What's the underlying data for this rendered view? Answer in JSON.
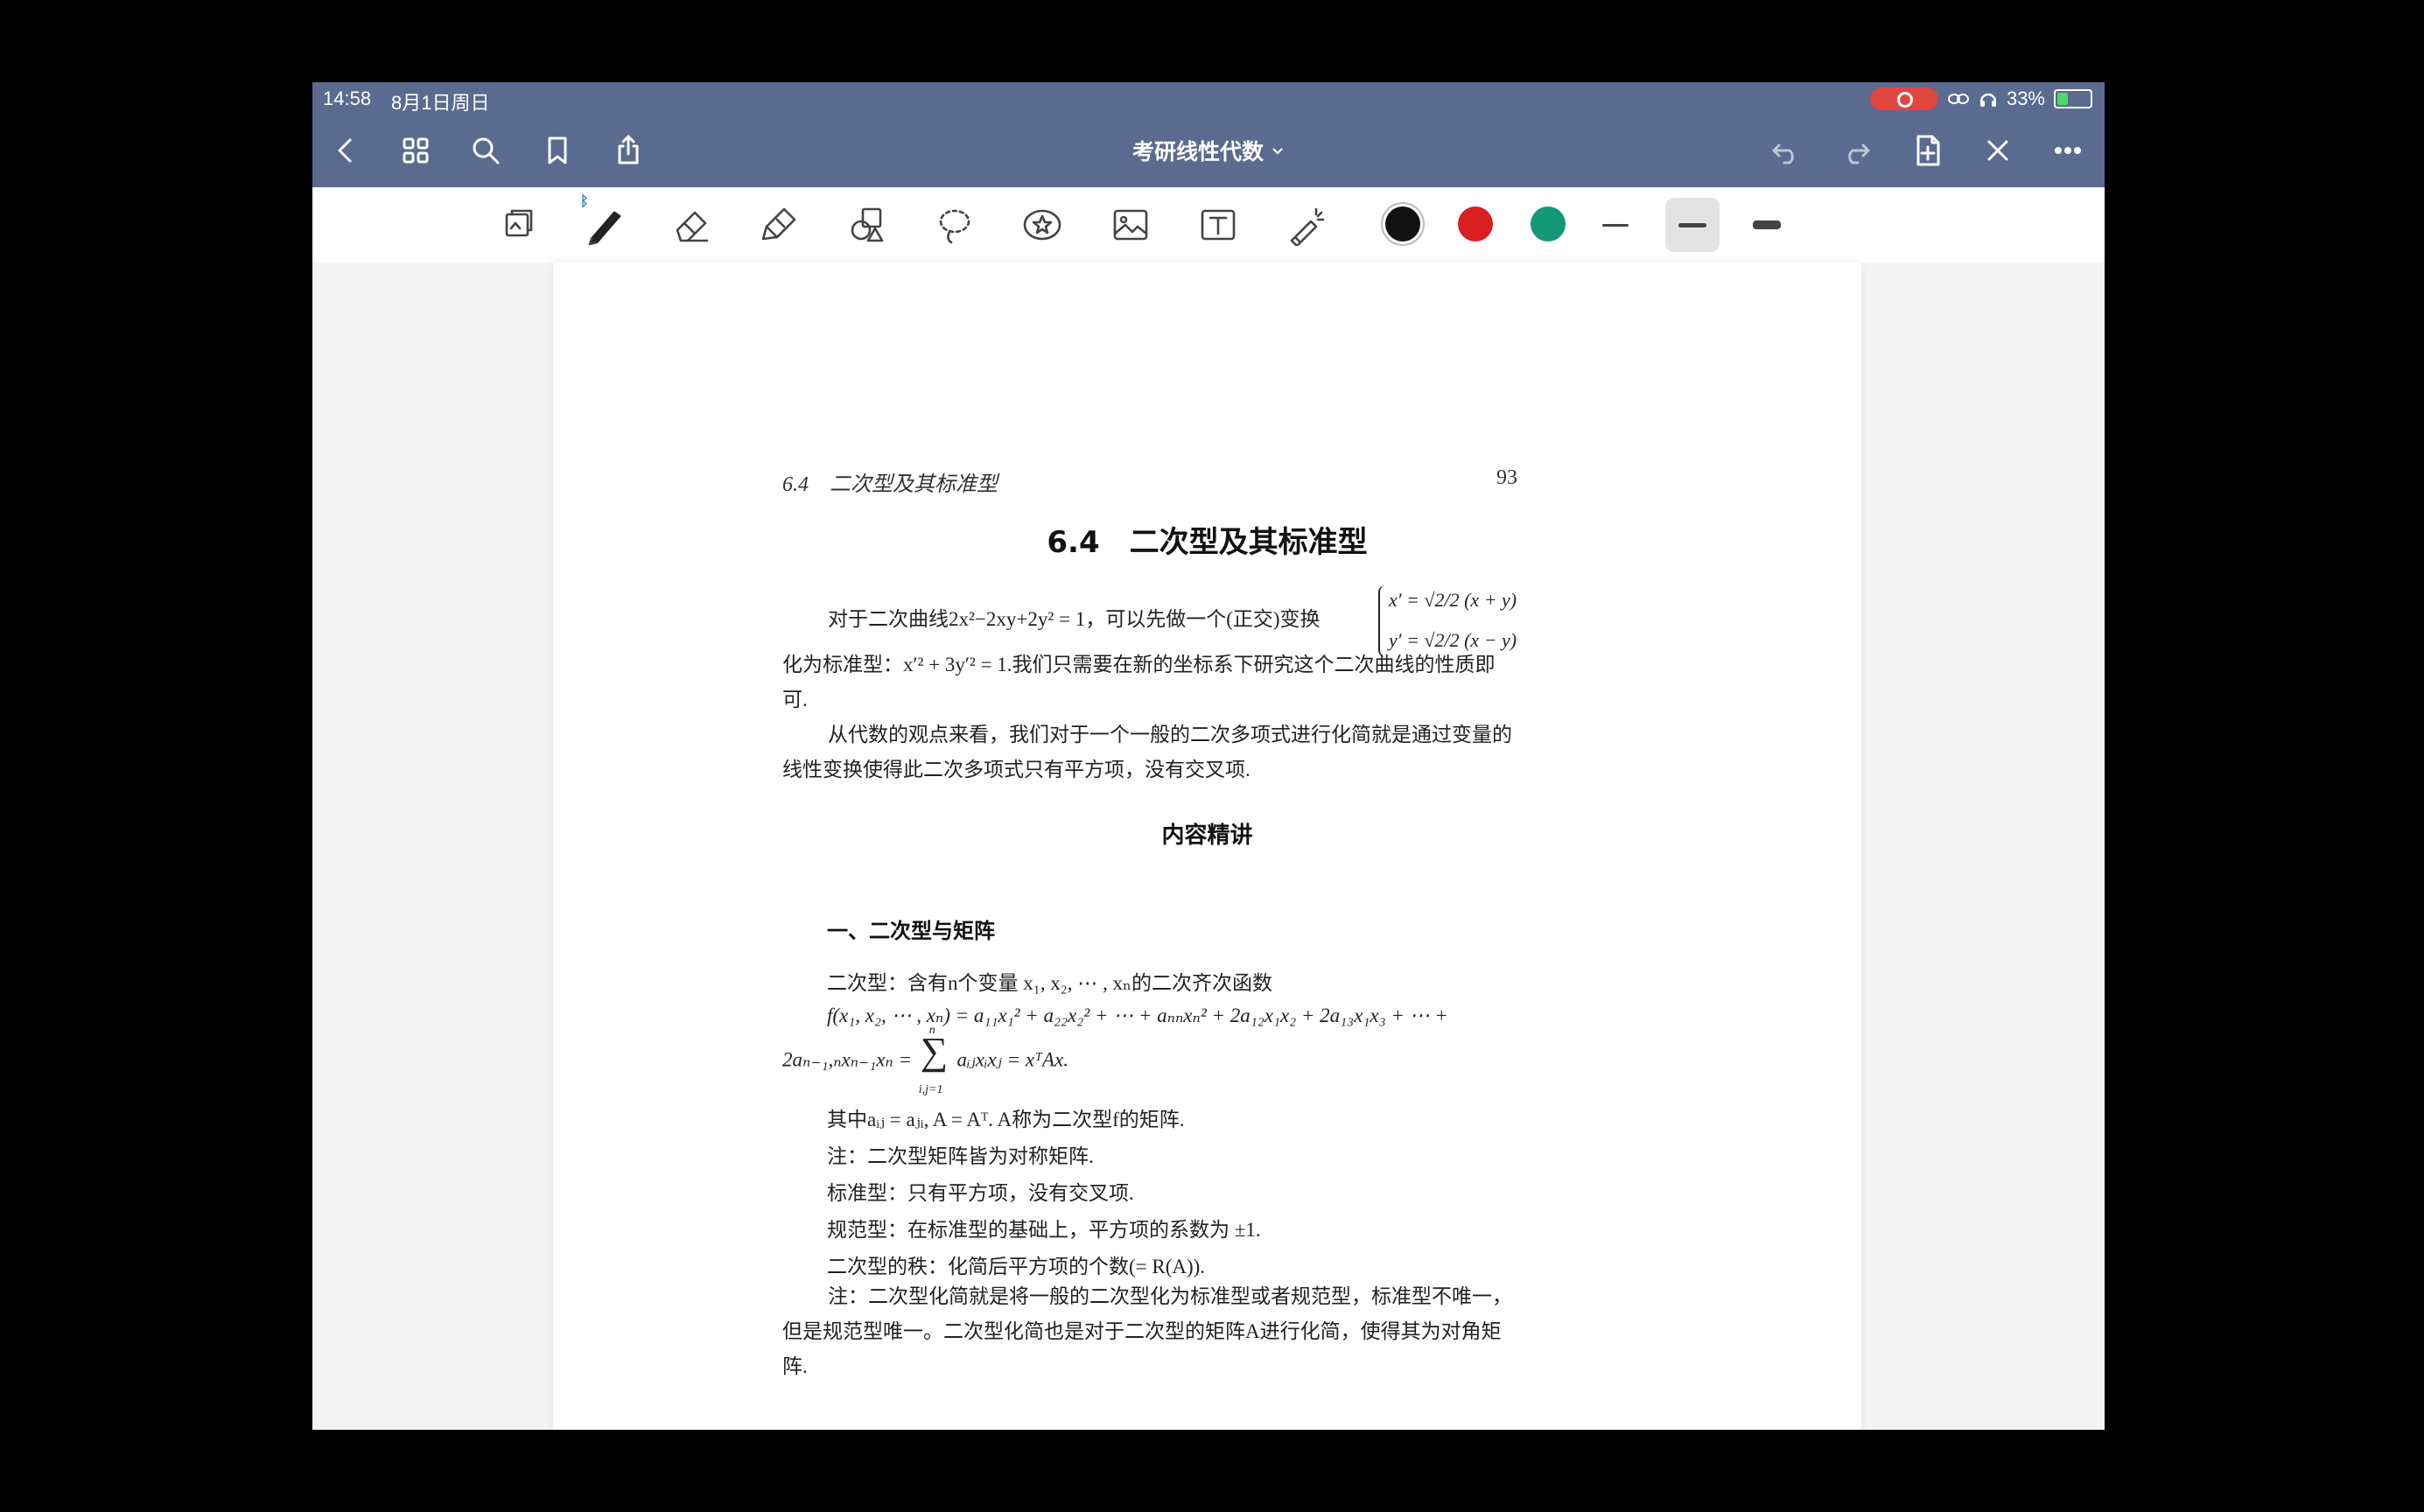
{
  "status": {
    "time": "14:58",
    "date": "8月1日周日",
    "battery": "33%",
    "battery_level": 0.33
  },
  "nav": {
    "title": "考研线性代数",
    "icons": [
      "back-icon",
      "grid-icon",
      "search-icon",
      "bookmark-icon",
      "share-icon",
      "undo-icon",
      "redo-icon",
      "add-page-icon",
      "close-icon",
      "more-icon"
    ]
  },
  "toolbar": {
    "tools": [
      "page-view-icon",
      "pen-icon",
      "eraser-icon",
      "highlighter-icon",
      "shapes-icon",
      "lasso-icon",
      "sticker-icon",
      "image-icon",
      "text-icon",
      "laser-pointer-icon"
    ],
    "colors": [
      "#111111",
      "#d91f1f",
      "#139978"
    ],
    "selected_color": "#111111",
    "thickness_options": [
      "thin",
      "medium",
      "thick"
    ],
    "selected_thickness": "medium"
  },
  "page": {
    "running_header_left": "6.4　二次型及其标准型",
    "page_number": "93",
    "section_title": "6.4　二次型及其标准型",
    "intro_1": "对于二次曲线2x²−2xy+2y² = 1，可以先做一个(正交)变换",
    "transform_x": "x′ = √2/2 (x + y)",
    "transform_y": "y′ = √2/2 (x − y)",
    "intro_2": "化为标准型：x′² + 3y′² = 1.我们只需要在新的坐标系下研究这个二次曲线的性质即可.",
    "intro_3": "从代数的观点来看，我们对于一个一般的二次多项式进行化简就是通过变量的线性变换使得此二次多项式只有平方项，没有交叉项.",
    "content_heading": "内容精讲",
    "subheading_1": "一、二次型与矩阵",
    "def_1": "二次型：含有n个变量 x₁, x₂, ⋯ , xₙ的二次齐次函数",
    "formula_1": "f(x₁, x₂, ⋯ , xₙ) = a₁₁x₁² + a₂₂x₂² + ⋯ + aₙₙxₙ² + 2a₁₂x₁x₂ + 2a₁₃x₁x₃ + ⋯ +",
    "formula_2_left": "2aₙ₋₁,ₙxₙ₋₁xₙ =",
    "formula_2_right": "aᵢⱼxᵢxⱼ = xᵀAx.",
    "sum_sup": "n",
    "sum_sub": "i,j=1",
    "note_1": "其中aᵢⱼ = aⱼᵢ, A = Aᵀ. A称为二次型f的矩阵.",
    "note_2": "注：二次型矩阵皆为对称矩阵.",
    "note_3": "标准型：只有平方项，没有交叉项.",
    "note_4": "规范型：在标准型的基础上，平方项的系数为 ±1.",
    "note_5": "二次型的秩：化简后平方项的个数(= R(A)).",
    "note_6": "注：二次型化简就是将一般的二次型化为标准型或者规范型，标准型不唯一，但是规范型唯一。二次型化简也是对于二次型的矩阵A进行化简，使得其为对角矩阵."
  }
}
